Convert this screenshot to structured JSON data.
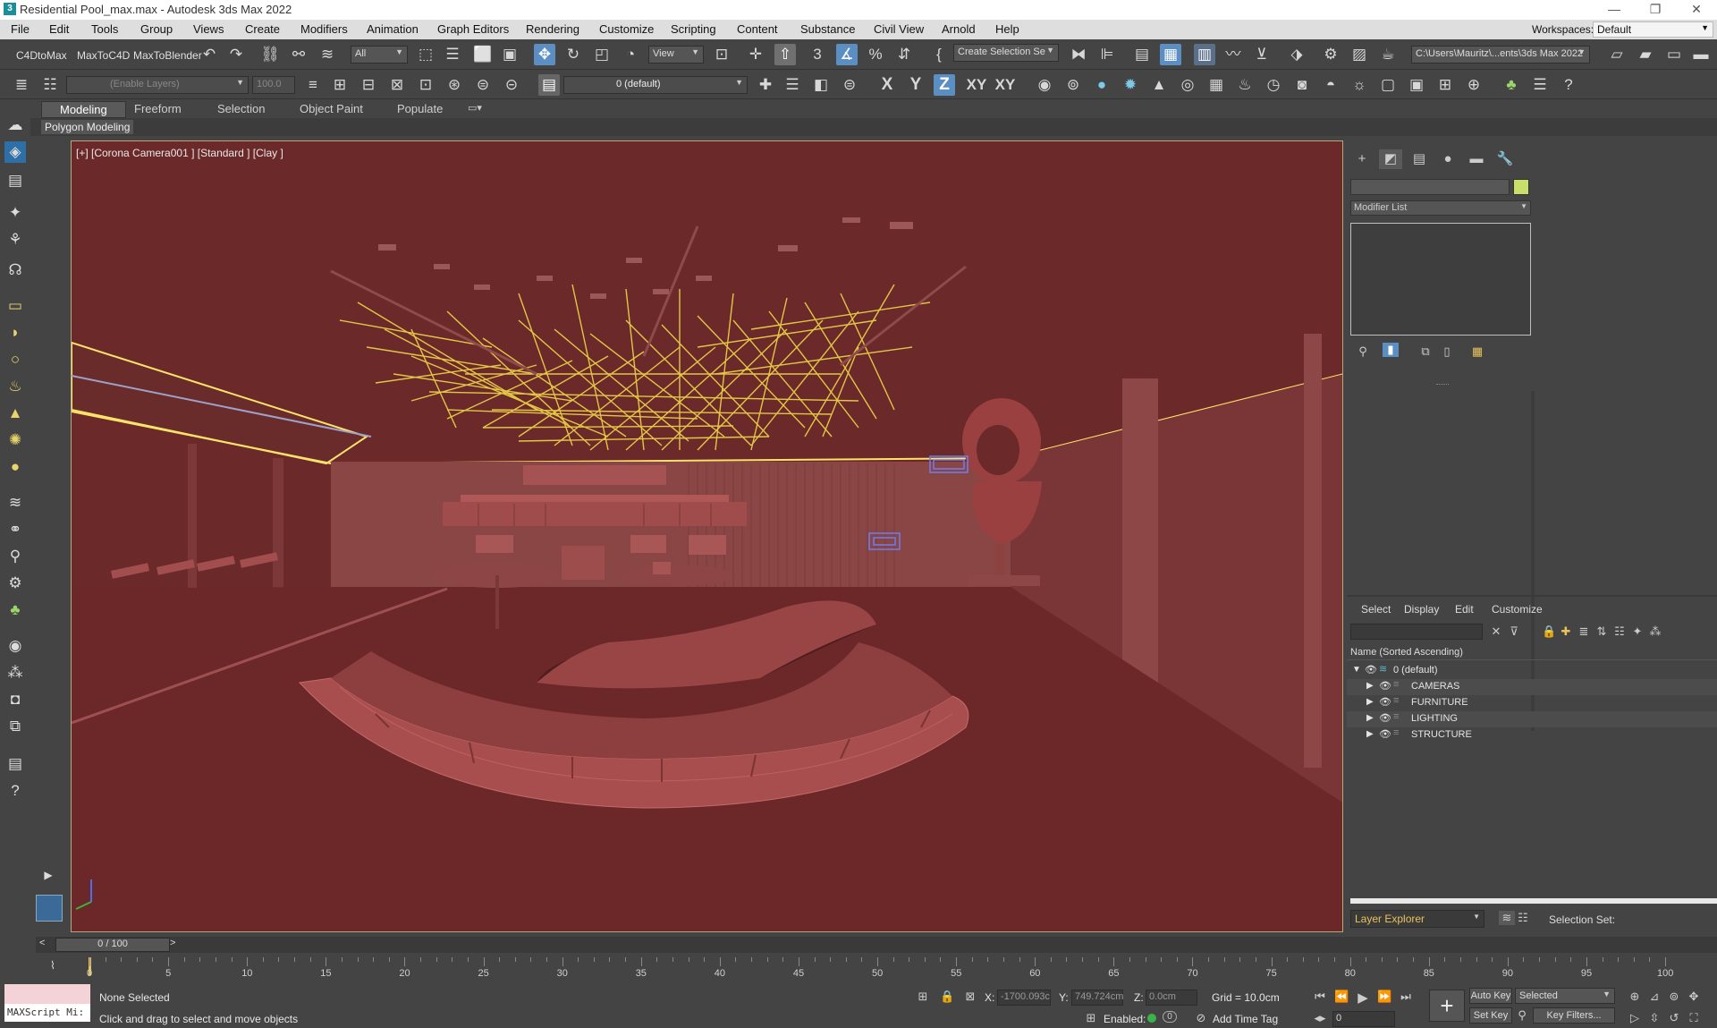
{
  "window": {
    "title": "Residential Pool_max.max - Autodesk 3ds Max 2022",
    "logo": "3"
  },
  "menu": [
    "File",
    "Edit",
    "Tools",
    "Group",
    "Views",
    "Create",
    "Modifiers",
    "Animation",
    "Graph Editors",
    "Rendering",
    "Customize",
    "Scripting",
    "Content",
    "Substance",
    "Civil View",
    "Arnold",
    "Help"
  ],
  "workspaces": {
    "label": "Workspaces:",
    "value": "Default"
  },
  "toolbar1": {
    "plugins": [
      "C4DtoMax",
      "MaxToC4D",
      "MaxToBlender"
    ],
    "selection_filter": "All",
    "ref_coord": "View",
    "create_selection_set": "Create Selection Se",
    "project_path": "C:\\Users\\Mauritz\\...ents\\3ds Max 2022"
  },
  "toolbar2": {
    "enable_layers_placeholder": "(Enable Layers)",
    "opacity_value": "100.0",
    "layer_name": "0 (default)",
    "axis": [
      "X",
      "Y",
      "Z",
      "XY",
      "XY"
    ]
  },
  "ribbon": {
    "tabs": [
      "Modeling",
      "Freeform",
      "Selection",
      "Object Paint",
      "Populate"
    ],
    "active": "Modeling",
    "sub": "Polygon Modeling"
  },
  "viewport": {
    "label": "[+] [Corona Camera001 ] [Standard ] [Clay ]",
    "background": "#6d2a2a"
  },
  "command_panel": {
    "modifier_list": "Modifier List",
    "color_swatch": "#c8e06a"
  },
  "scene_explorer": {
    "tabs": [
      "Select",
      "Display",
      "Edit",
      "Customize"
    ],
    "column_header": "Name (Sorted Ascending)",
    "root": "0 (default)",
    "layers": [
      "CAMERAS",
      "FURNITURE",
      "LIGHTING",
      "STRUCTURE"
    ],
    "explorer_name": "Layer Explorer",
    "selection_set_label": "Selection Set:"
  },
  "timeline": {
    "position": "0 / 100",
    "ticks": [
      "0",
      "5",
      "10",
      "15",
      "20",
      "25",
      "30",
      "35",
      "40",
      "45",
      "50",
      "55",
      "60",
      "65",
      "70",
      "75",
      "80",
      "85",
      "90",
      "95",
      "100"
    ]
  },
  "status": {
    "maxscript": "MAXScript Mi:",
    "selection": "None Selected",
    "prompt": "Click and drag to select and move objects",
    "x_label": "X:",
    "x_value": "-1700.093c",
    "y_label": "Y:",
    "y_value": "749.724cm",
    "z_label": "Z:",
    "z_value": "0.0cm",
    "grid": "Grid = 10.0cm",
    "enabled_label": "Enabled:",
    "add_time_tag": "Add Time Tag",
    "auto_key": "Auto Key",
    "set_key": "Set Key",
    "key_mode": "Selected",
    "key_filters": "Key Filters...",
    "frame": "0"
  }
}
